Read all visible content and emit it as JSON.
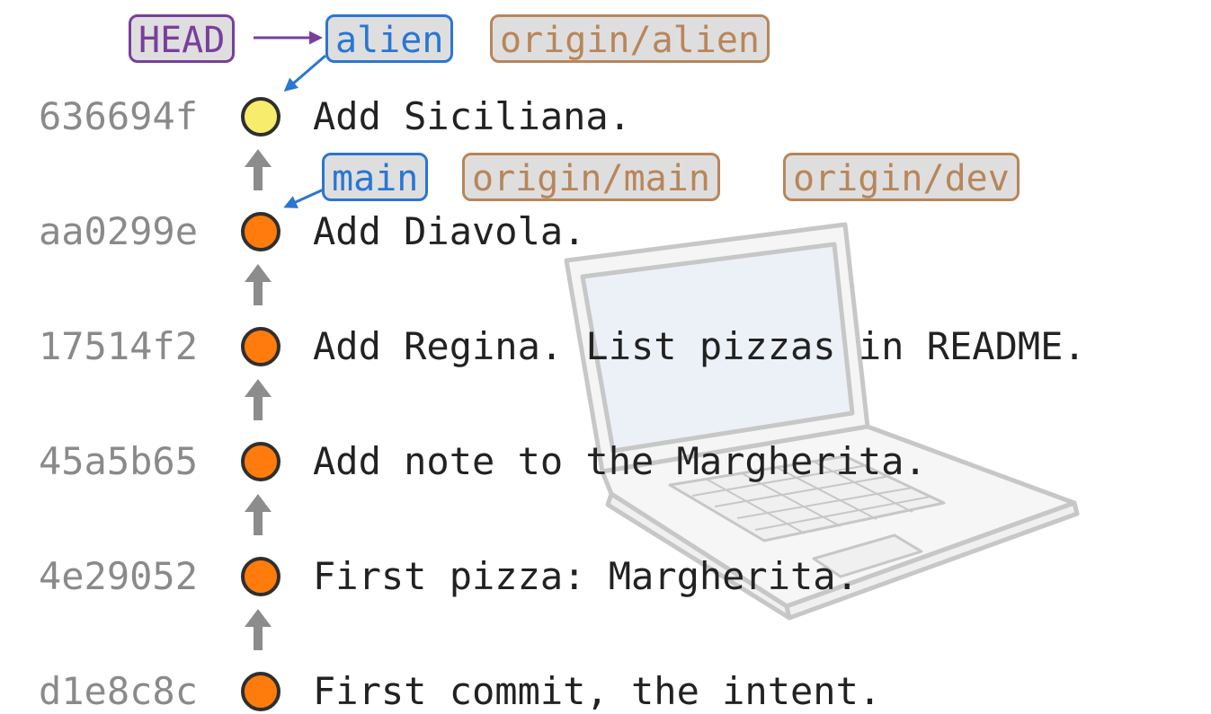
{
  "refs": {
    "head": "HEAD",
    "alien": "alien",
    "origin_alien": "origin/alien",
    "main": "main",
    "origin_main": "origin/main",
    "origin_dev": "origin/dev"
  },
  "commits": [
    {
      "hash": "636694f",
      "message": "Add Siciliana.",
      "color": "#f7ec6c"
    },
    {
      "hash": "aa0299e",
      "message": "Add Diavola.",
      "color": "#ff7b0c"
    },
    {
      "hash": "17514f2",
      "message": "Add Regina. List pizzas in README.",
      "color": "#ff7b0c"
    },
    {
      "hash": "45a5b65",
      "message": "Add note to the Margherita.",
      "color": "#ff7b0c"
    },
    {
      "hash": "4e29052",
      "message": "First pizza: Margherita.",
      "color": "#ff7b0c"
    },
    {
      "hash": "d1e8c8c",
      "message": "First commit, the intent.",
      "color": "#ff7b0c"
    }
  ],
  "colors": {
    "head": "#7a3e9c",
    "branch": "#2a76d2",
    "remote": "#b8865a",
    "label_bg": "#dedede",
    "arrow": "#8c8c8c",
    "node_border": "#2f2f2f"
  },
  "decoration": "laptop-illustration"
}
